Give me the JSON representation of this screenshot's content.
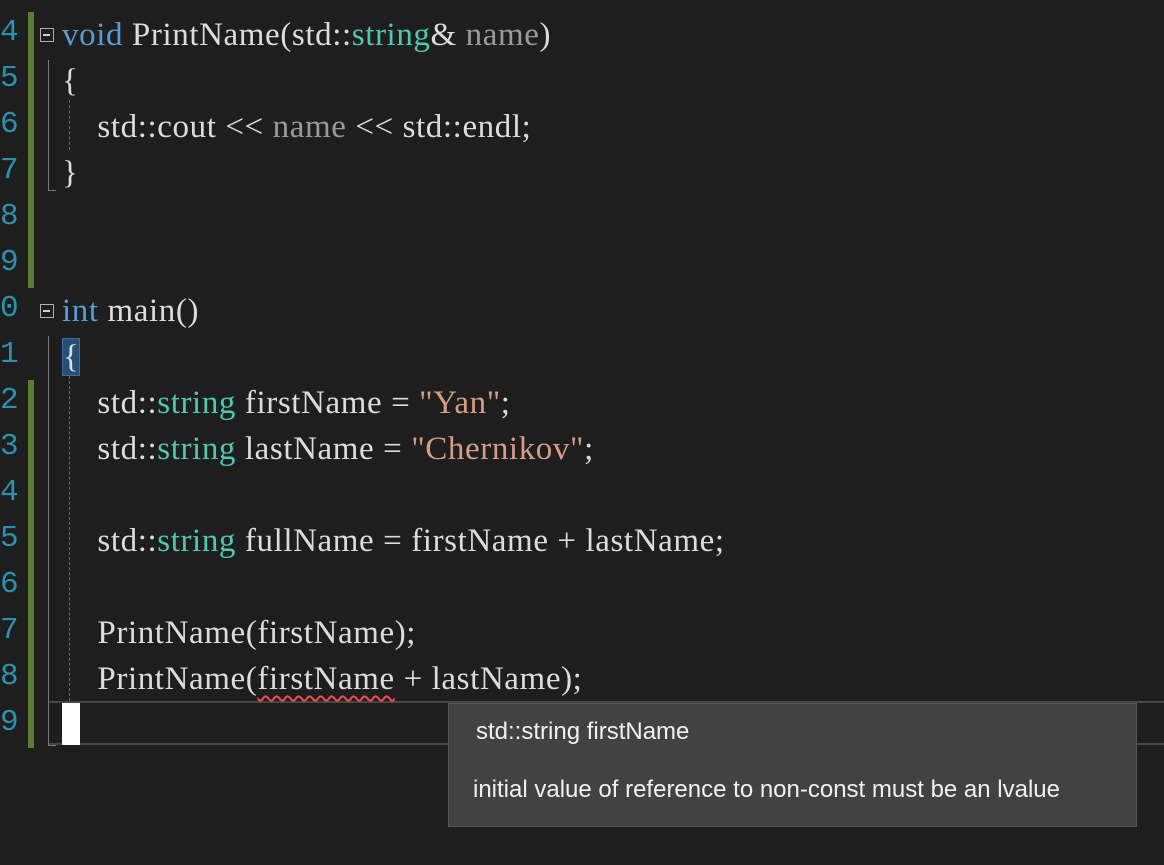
{
  "editor": {
    "lines": [
      {
        "num": "4",
        "tokens": [
          {
            "cls": "kw",
            "text": "void"
          },
          {
            "cls": "plain",
            "text": " PrintName(std::"
          },
          {
            "cls": "ty",
            "text": "string"
          },
          {
            "cls": "plain",
            "text": "& "
          },
          {
            "cls": "pm",
            "text": "name"
          },
          {
            "cls": "plain",
            "text": ")"
          }
        ]
      },
      {
        "num": "5",
        "tokens": [
          {
            "cls": "plain",
            "text": "{"
          }
        ]
      },
      {
        "num": "6",
        "tokens": [
          {
            "cls": "plain",
            "text": "    std::cout << "
          },
          {
            "cls": "pm",
            "text": "name"
          },
          {
            "cls": "plain",
            "text": " << std::endl;"
          }
        ]
      },
      {
        "num": "7",
        "tokens": [
          {
            "cls": "plain",
            "text": "}"
          }
        ]
      },
      {
        "num": "8",
        "tokens": []
      },
      {
        "num": "9",
        "tokens": []
      },
      {
        "num": "0",
        "tokens": [
          {
            "cls": "kw",
            "text": "int"
          },
          {
            "cls": "plain",
            "text": " main()"
          }
        ]
      },
      {
        "num": "1",
        "tokens": [
          {
            "cls": "plain brace-hl",
            "text": "{"
          }
        ]
      },
      {
        "num": "2",
        "tokens": [
          {
            "cls": "plain",
            "text": "    std::"
          },
          {
            "cls": "ty",
            "text": "string"
          },
          {
            "cls": "plain",
            "text": " firstName = "
          },
          {
            "cls": "st",
            "text": "\"Yan\""
          },
          {
            "cls": "plain",
            "text": ";"
          }
        ]
      },
      {
        "num": "3",
        "tokens": [
          {
            "cls": "plain",
            "text": "    std::"
          },
          {
            "cls": "ty",
            "text": "string"
          },
          {
            "cls": "plain",
            "text": " lastName = "
          },
          {
            "cls": "st",
            "text": "\"Chernikov\""
          },
          {
            "cls": "plain",
            "text": ";"
          }
        ]
      },
      {
        "num": "4",
        "tokens": []
      },
      {
        "num": "5",
        "tokens": [
          {
            "cls": "plain",
            "text": "    std::"
          },
          {
            "cls": "ty",
            "text": "string"
          },
          {
            "cls": "plain",
            "text": " fullName = firstName + lastName;"
          }
        ]
      },
      {
        "num": "6",
        "tokens": []
      },
      {
        "num": "7",
        "tokens": [
          {
            "cls": "plain",
            "text": "    PrintName(firstName);"
          }
        ]
      },
      {
        "num": "8",
        "tokens": [
          {
            "cls": "plain",
            "text": "    PrintName("
          },
          {
            "cls": "plain squiggle",
            "text": "firstName"
          },
          {
            "cls": "plain",
            "text": " + lastName);"
          }
        ]
      },
      {
        "num": "9",
        "tokens": []
      }
    ],
    "changed_lines": [
      true,
      true,
      true,
      true,
      true,
      true,
      false,
      false,
      true,
      true,
      true,
      true,
      true,
      true,
      true,
      true
    ],
    "fold_lines": [
      0,
      6
    ],
    "colors": {
      "keyword": "#569cd6",
      "type": "#4ec9b0",
      "parameter": "#9a9a9a",
      "string": "#d69d85",
      "line_number": "#2b91af",
      "change_bar": "#5b7b33",
      "error_squiggle": "#f14c4c"
    }
  },
  "tooltip": {
    "signature": "std::string firstName",
    "message": "initial value of reference to non-const must be an lvalue"
  }
}
